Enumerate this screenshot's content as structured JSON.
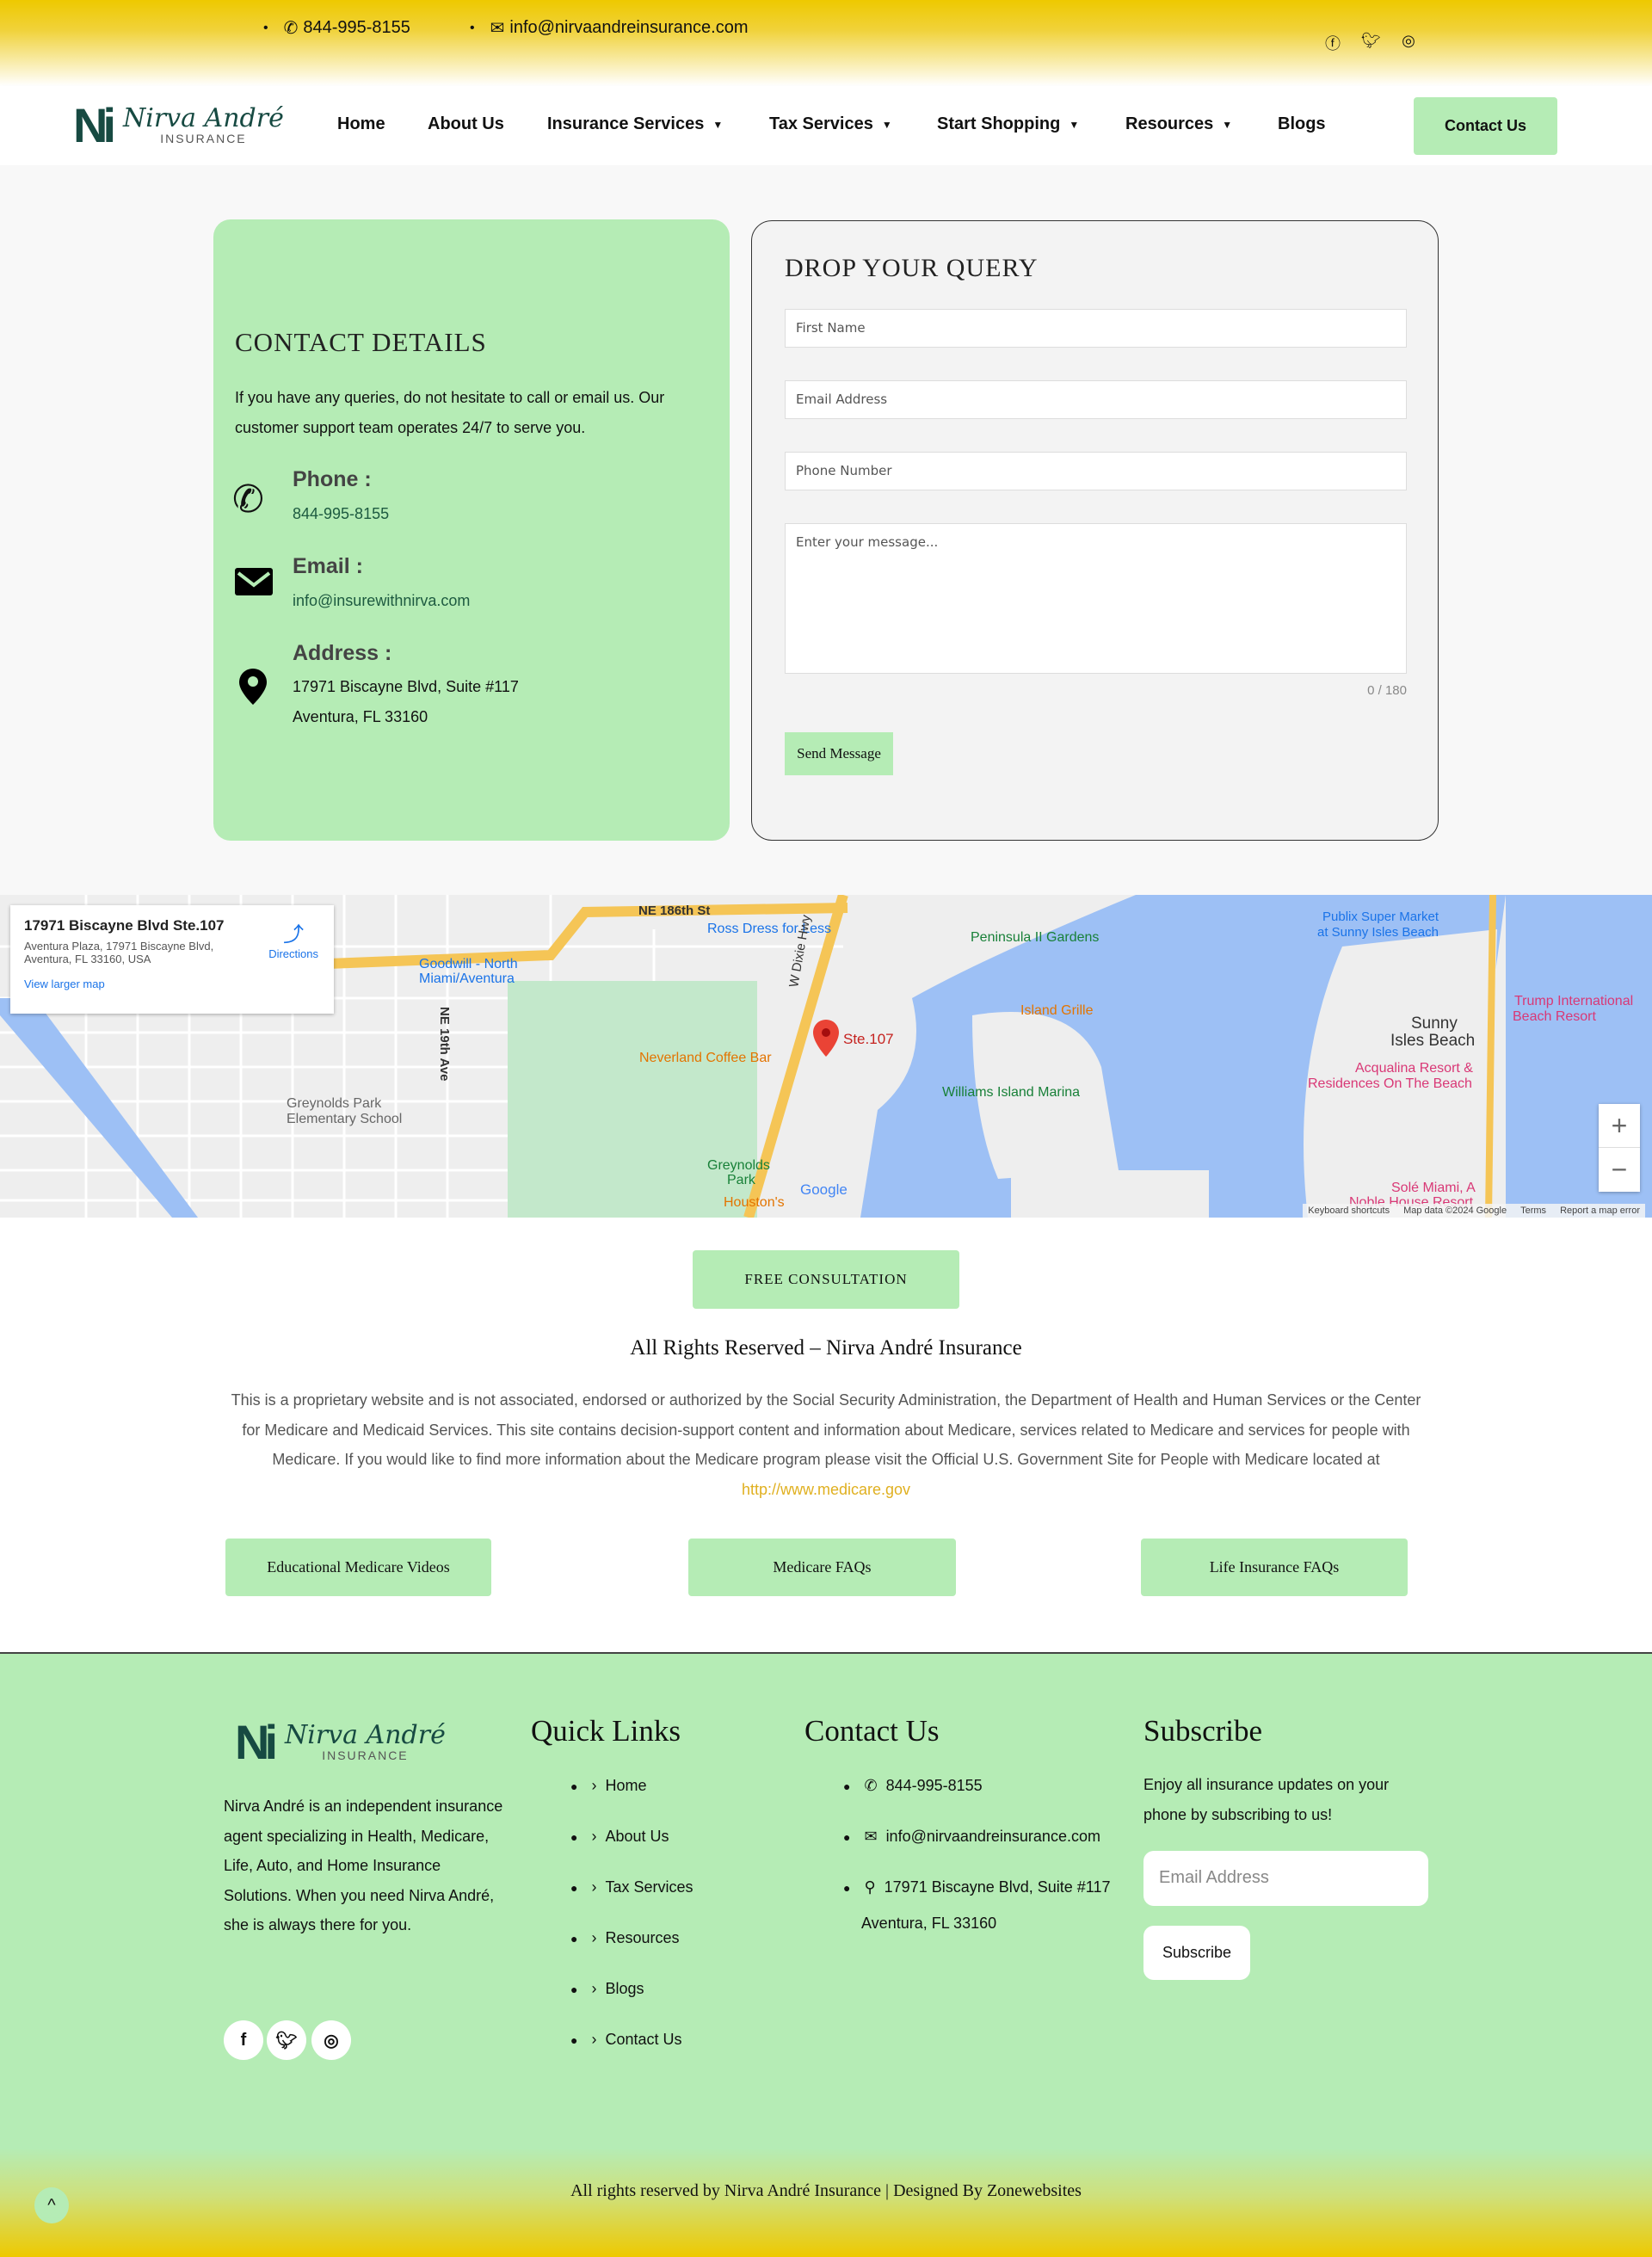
{
  "topbar": {
    "phone": "844-995-8155",
    "email": "info@nirvaandreinsurance.com",
    "social": [
      "facebook-icon",
      "twitter-icon",
      "instagram-icon"
    ]
  },
  "logo": {
    "mark": "Ni",
    "script": "Nirva André",
    "sub": "INSURANCE"
  },
  "nav": {
    "items": [
      {
        "label": "Home"
      },
      {
        "label": "About Us"
      },
      {
        "label": "Insurance Services",
        "dropdown": true
      },
      {
        "label": "Tax Services",
        "dropdown": true
      },
      {
        "label": "Start Shopping",
        "dropdown": true
      },
      {
        "label": "Resources",
        "dropdown": true
      },
      {
        "label": "Blogs"
      }
    ],
    "cta": "Contact Us"
  },
  "contact_details": {
    "title": "CONTACT DETAILS",
    "intro": "If you have any queries, do not hesitate to call or email us. Our customer support team operates 24/7 to serve you.",
    "phone_label": "Phone :",
    "phone": "844-995-8155",
    "email_label": "Email :",
    "email": "info@insurewithnirva.com",
    "address_label": "Address :",
    "address_line1": "17971 Biscayne Blvd, Suite #117",
    "address_line2": "Aventura, FL 33160"
  },
  "query_form": {
    "title": "DROP YOUR QUERY",
    "first_name_placeholder": "First Name",
    "email_placeholder": "Email Address",
    "phone_placeholder": "Phone Number",
    "message_placeholder": "Enter your message...",
    "counter": "0 / 180",
    "submit": "Send Message"
  },
  "map": {
    "card_title": "17971 Biscayne Blvd Ste.107",
    "card_address1": "Aventura Plaza, 17971 Biscayne Blvd,",
    "card_address2": "Aventura, FL 33160, USA",
    "directions": "Directions",
    "larger_map": "View larger map",
    "marker_label": "Ste.107",
    "labels": {
      "ne186": "NE 186th St",
      "ross": "Ross Dress for Less",
      "goodwill1": "Goodwill - North",
      "goodwill2": "Miami/Aventura",
      "peninsula": "Peninsula II Gardens",
      "publix1": "Publix Super Market",
      "publix2": "at Sunny Isles Beach",
      "trump1": "Trump International",
      "trump2": "Beach Resort",
      "sunny1": "Sunny",
      "sunny2": "Isles Beach",
      "island_grille": "Island Grille",
      "neverland": "Neverland Coffee Bar",
      "williams": "Williams Island Marina",
      "acqualina1": "Acqualina Resort &",
      "acqualina2": "Residences On The Beach",
      "greynolds1": "Greynolds Park",
      "greynolds2": "Elementary School",
      "greynolds_park1": "Greynolds",
      "greynolds_park2": "Park",
      "houstons": "Houston's",
      "sole1": "Solé Miami, A",
      "sole2": "Noble House Resort",
      "ne19": "NE 19th Ave",
      "wdixie": "W Dixie Hwy",
      "google": "Google"
    },
    "attribution": {
      "shortcuts": "Keyboard shortcuts",
      "mapdata": "Map data ©2024 Google",
      "terms": "Terms",
      "report": "Report a map error"
    },
    "zoom_in": "+",
    "zoom_out": "−"
  },
  "disclaimer": {
    "cta": "FREE CONSULTATION",
    "heading": "All Rights Reserved – Nirva André Insurance",
    "text": "This is a proprietary website and is not associated, endorsed or authorized by the Social Security Administration, the Department of Health and Human Services or the Center for Medicare and Medicaid Services. This site contains decision-support content and information about Medicare, services related to Medicare and services for people with Medicare. If you would like to find more information about the Medicare program please visit the Official U.S. Government Site for People with Medicare located at ",
    "link": "http://www.medicare.gov",
    "buttons": [
      "Educational Medicare Videos",
      "Medicare FAQs",
      "Life Insurance FAQs"
    ]
  },
  "footer": {
    "about": "Nirva André is an independent insurance agent specializing in Health, Medicare, Life, Auto, and Home Insurance Solutions. When you need Nirva André, she is always there for you.",
    "quick_links_title": "Quick Links",
    "quick_links": [
      "Home",
      "About Us",
      "Tax Services",
      "Resources",
      "Blogs",
      "Contact Us"
    ],
    "contact_title": "Contact Us",
    "phone": "844-995-8155",
    "email": "info@nirvaandreinsurance.com",
    "address1": "17971 Biscayne Blvd, Suite #117",
    "address2": "Aventura, FL 33160",
    "subscribe_title": "Subscribe",
    "subscribe_text": "Enjoy all insurance updates on your phone by subscribing to us!",
    "email_placeholder": "Email Address",
    "subscribe_button": "Subscribe",
    "copyright": "All rights reserved by Nirva André Insurance | Designed By Zonewebsites"
  },
  "colors": {
    "accent_green": "#b5ecb5",
    "top_yellow": "#eec900",
    "logo_teal": "#174a42",
    "link_gold": "#e0b020"
  }
}
